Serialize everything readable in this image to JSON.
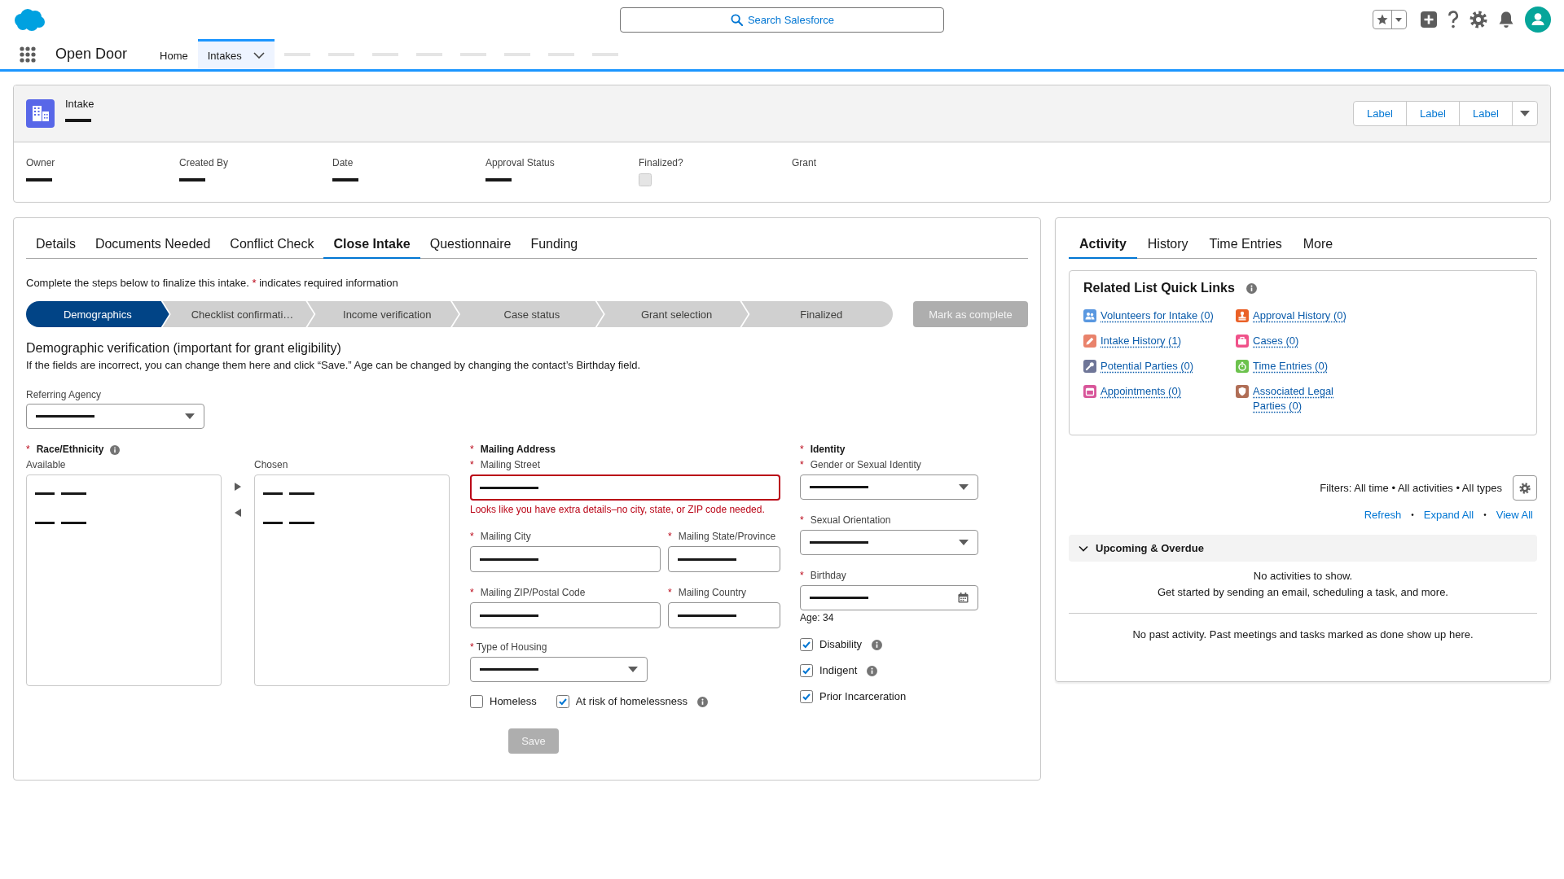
{
  "header": {
    "search": {
      "placeholder": "Search Salesforce"
    }
  },
  "nav": {
    "app_name": "Open Door",
    "items": [
      {
        "kind": "link",
        "label": "Home",
        "selected": false
      },
      {
        "kind": "menu",
        "label": "Intakes",
        "selected": true
      },
      {
        "kind": "placeholder",
        "selected": false
      },
      {
        "kind": "placeholder",
        "selected": false
      },
      {
        "kind": "placeholder",
        "selected": false
      },
      {
        "kind": "placeholder",
        "selected": false
      },
      {
        "kind": "placeholder",
        "selected": false
      },
      {
        "kind": "placeholder",
        "selected": false
      },
      {
        "kind": "placeholder",
        "selected": false
      },
      {
        "kind": "placeholder",
        "selected": false
      }
    ]
  },
  "required_marker": "*",
  "record": {
    "object_label": "Intake",
    "name_redacted": true,
    "actions": [
      {
        "label": "Label"
      },
      {
        "label": "Label"
      },
      {
        "label": "Label"
      }
    ],
    "highlights": [
      {
        "kind": "text",
        "label": "Owner",
        "redacted": true
      },
      {
        "kind": "text",
        "label": "Created By",
        "redacted": true
      },
      {
        "kind": "text",
        "label": "Date",
        "redacted": true
      },
      {
        "kind": "text",
        "label": "Approval Status",
        "redacted": true
      },
      {
        "kind": "checkbox",
        "label": "Finalized?",
        "checked": false,
        "disabled": true
      },
      {
        "kind": "text",
        "label": "Grant"
      }
    ]
  },
  "main": {
    "tabs": [
      {
        "label": "Details",
        "selected": false
      },
      {
        "label": "Documents Needed",
        "selected": false
      },
      {
        "label": "Conflict Check",
        "selected": false
      },
      {
        "label": "Close Intake",
        "selected": true
      },
      {
        "label": "Questionnaire",
        "selected": false
      },
      {
        "label": "Funding",
        "selected": false
      }
    ],
    "instructions": {
      "text": "Complete the steps below to finalize this intake.",
      "mark": "*",
      "note": "indicates required information"
    },
    "path": {
      "steps": [
        {
          "label": "Demographics",
          "selected": true
        },
        {
          "label": "Checklist confirmati…",
          "selected": false
        },
        {
          "label": "Income verification",
          "selected": false
        },
        {
          "label": "Case status",
          "selected": false
        },
        {
          "label": "Grant selection",
          "selected": false
        },
        {
          "label": "Finalized",
          "selected": false
        }
      ],
      "complete_button": {
        "label": "Mark as complete",
        "disabled": true
      }
    },
    "section": {
      "title": "Demographic verification (important for grant eligibility)",
      "description": "If the fields are incorrect, you can change them here and click “Save.” Age can be changed by changing the contact’s Birthday field."
    },
    "referring_agency": {
      "label": "Referring Agency",
      "redacted": true
    },
    "race": {
      "label": "Race/Ethnicity",
      "required": true,
      "info": true,
      "available": {
        "label": "Available",
        "options": [
          {
            "redacted": true
          },
          {
            "redacted": true
          }
        ]
      },
      "chosen": {
        "label": "Chosen",
        "options": [
          {
            "redacted": true
          },
          {
            "redacted": true
          }
        ]
      }
    },
    "address": {
      "title": "Mailing Address",
      "required": true,
      "street": {
        "label": "Mailing Street",
        "required": true,
        "redacted": true,
        "error": "Looks like you have extra details–no city, state, or ZIP code needed."
      },
      "city": {
        "label": "Mailing City",
        "required": true,
        "redacted": true
      },
      "state": {
        "label": "Mailing State/Province",
        "required": true,
        "redacted": true
      },
      "zip": {
        "label": "Mailing ZIP/Postal Code",
        "required": true,
        "redacted": true
      },
      "country": {
        "label": "Mailing Country",
        "required": true,
        "redacted": true
      },
      "housing": {
        "label": "Type of Housing",
        "required": true,
        "redacted": true
      },
      "checkboxes": [
        {
          "label": "Homeless",
          "checked": false
        },
        {
          "label": "At risk of homelessness",
          "checked": true,
          "info": true
        }
      ]
    },
    "identity": {
      "title": "Identity",
      "required": true,
      "gender": {
        "label": "Gender or Sexual Identity",
        "required": true,
        "redacted": true
      },
      "orientation": {
        "label": "Sexual Orientation",
        "required": true,
        "redacted": true
      },
      "birthday": {
        "label": "Birthday",
        "required": true,
        "redacted": true,
        "age": "Age: 34"
      },
      "checkboxes": [
        {
          "label": "Disability",
          "checked": true,
          "info": true
        },
        {
          "label": "Indigent",
          "checked": true,
          "info": true
        },
        {
          "label": "Prior Incarceration",
          "checked": true
        }
      ]
    },
    "save_button": {
      "label": "Save",
      "disabled": true
    }
  },
  "activity": {
    "tabs": [
      {
        "label": "Activity",
        "selected": true
      },
      {
        "label": "History",
        "selected": false
      },
      {
        "label": "Time Entries",
        "selected": false
      },
      {
        "label": "More",
        "selected": false
      }
    ],
    "quick_links": {
      "title": "Related List Quick Links",
      "info": true,
      "items": [
        {
          "label": "Volunteers for Intake (0)",
          "color": "#5a98e0"
        },
        {
          "label": "Approval History (0)",
          "color": "#ea6127"
        },
        {
          "label": "Intake History (1)",
          "color": "#e9826b"
        },
        {
          "label": "Cases (0)",
          "color": "#f0528a"
        },
        {
          "label": "Potential Parties (0)",
          "color": "#6f7698"
        },
        {
          "label": "Time Entries (0)",
          "color": "#6cc24d"
        },
        {
          "label": "Appointments (0)",
          "color": "#d8569a"
        },
        {
          "label": "Associated Legal Parties (0)",
          "color": "#b06e56"
        }
      ]
    },
    "filters": {
      "text": "Filters: All time • All activities • All types"
    },
    "links": {
      "separator": "•",
      "items": [
        "Refresh",
        "Expand All",
        "View All"
      ]
    },
    "upcoming": {
      "title": "Upcoming & Overdue",
      "expanded": true,
      "messages": [
        "No activities to show.",
        "Get started by sending an email, scheduling a task, and more."
      ]
    },
    "past": {
      "message": "No past activity. Past meetings and tasks marked as done show up here."
    }
  }
}
